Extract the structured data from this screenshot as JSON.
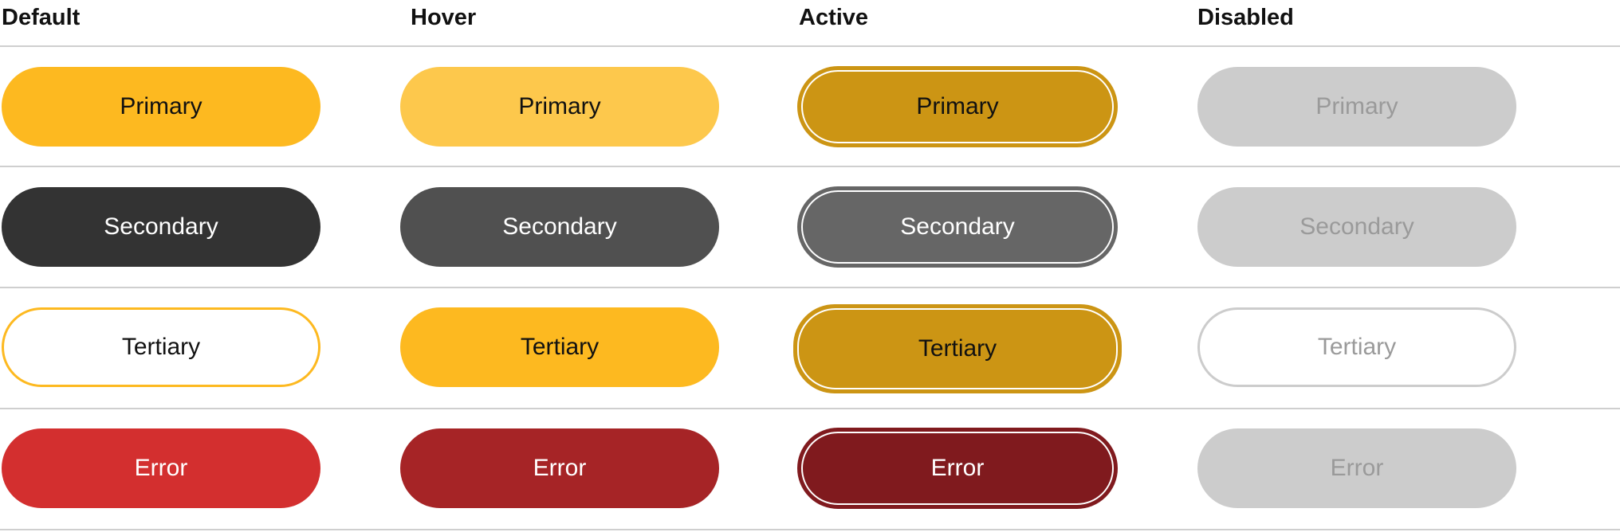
{
  "columns": [
    {
      "label": "Default"
    },
    {
      "label": "Hover"
    },
    {
      "label": "Active"
    },
    {
      "label": "Disabled"
    }
  ],
  "rows": [
    {
      "label": "Primary"
    },
    {
      "label": "Secondary"
    },
    {
      "label": "Tertiary"
    },
    {
      "label": "Error"
    }
  ],
  "colors": {
    "primary_default": "#fdb920",
    "primary_hover": "#fdc84c",
    "primary_active": "#cc9514",
    "secondary_default": "#333333",
    "secondary_hover": "#505050",
    "secondary_active": "#666666",
    "error_default": "#d32f2f",
    "error_hover": "#a62426",
    "error_active": "#801a1e",
    "disabled_fill": "#cccccc",
    "disabled_text": "#9a9a9a",
    "divider": "#cfcfcf"
  }
}
